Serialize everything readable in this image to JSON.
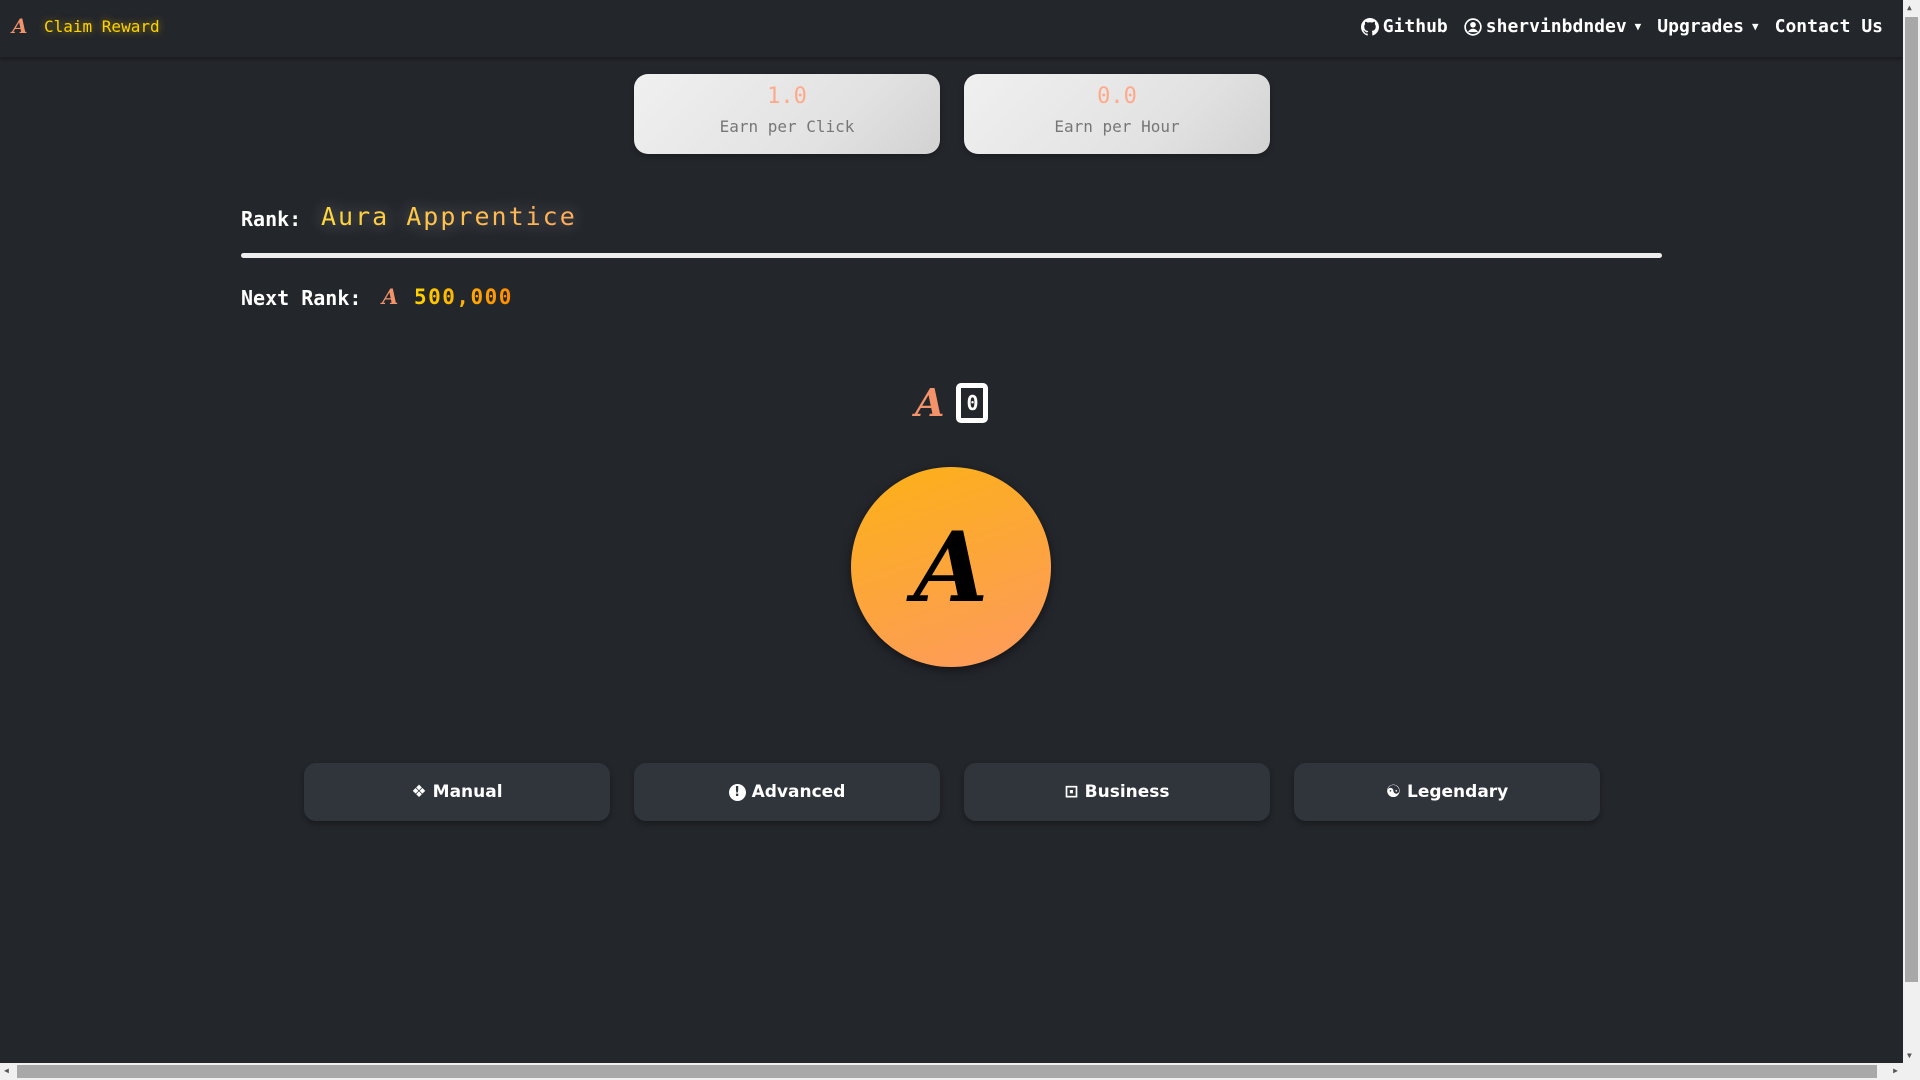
{
  "navbar": {
    "brand_logo": "A",
    "claim_reward": "Claim Reward",
    "github": "Github",
    "user": "shervinbdndev",
    "upgrades": "Upgrades",
    "contact": "Contact Us"
  },
  "stats": [
    {
      "value": "1.0",
      "label": "Earn per Click"
    },
    {
      "value": "0.0",
      "label": "Earn per Hour"
    }
  ],
  "rank": {
    "label": "Rank:",
    "value": "Aura Apprentice",
    "progress": 0
  },
  "next_rank": {
    "label": "Next Rank:",
    "currency_logo": "A",
    "value": "500,000"
  },
  "counter": {
    "currency_logo": "A",
    "value": "0"
  },
  "coin": {
    "logo": "A"
  },
  "upgrade_buttons": [
    {
      "label": "Manual",
      "icon": "diamonds-icon"
    },
    {
      "label": "Advanced",
      "icon": "exclamation-circle-icon"
    },
    {
      "label": "Business",
      "icon": "person-badge-icon"
    },
    {
      "label": "Legendary",
      "icon": "yin-yang-icon"
    }
  ],
  "colors": {
    "background": "#23262b",
    "accent": "#ffd200",
    "coin_start": "#fbb116",
    "coin_end": "#fe9a5f",
    "button": "#30343b"
  }
}
